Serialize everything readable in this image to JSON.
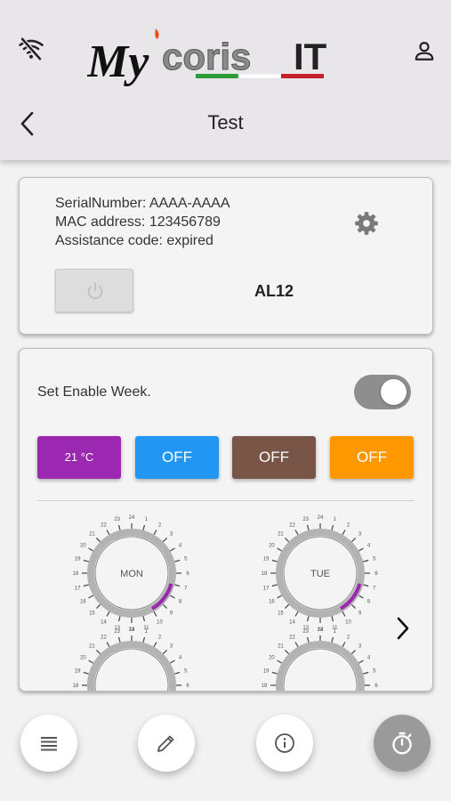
{
  "header": {
    "brand_text": "MycorisIT",
    "brand_colors": {
      "green": "#2e9b3a",
      "white": "#ffffff",
      "red": "#c8202a",
      "flame": "#e94e1b"
    },
    "title": "Test"
  },
  "icons": {
    "status": "wifi-off-icon",
    "account": "person-icon",
    "back": "chevron-left-icon",
    "settings": "gear-icon"
  },
  "device": {
    "serial": "SerialNumber: AAAA-AAAA",
    "mac": "MAC address: 123456789",
    "assistance": "Assistance code: expired",
    "model": "AL12"
  },
  "week": {
    "label": "Set Enable Week.",
    "enabled": true,
    "modes": [
      {
        "label": "21 °C",
        "color": "#9c27b0"
      },
      {
        "label": "OFF",
        "color": "#2196f3"
      },
      {
        "label": "OFF",
        "color": "#795548"
      },
      {
        "label": "OFF",
        "color": "#ff9800"
      }
    ],
    "days": [
      "MON",
      "TUE"
    ]
  },
  "nav": {
    "items": [
      "menu-icon",
      "edit-icon",
      "info-icon",
      "timer-icon"
    ],
    "active": "timer-icon"
  }
}
